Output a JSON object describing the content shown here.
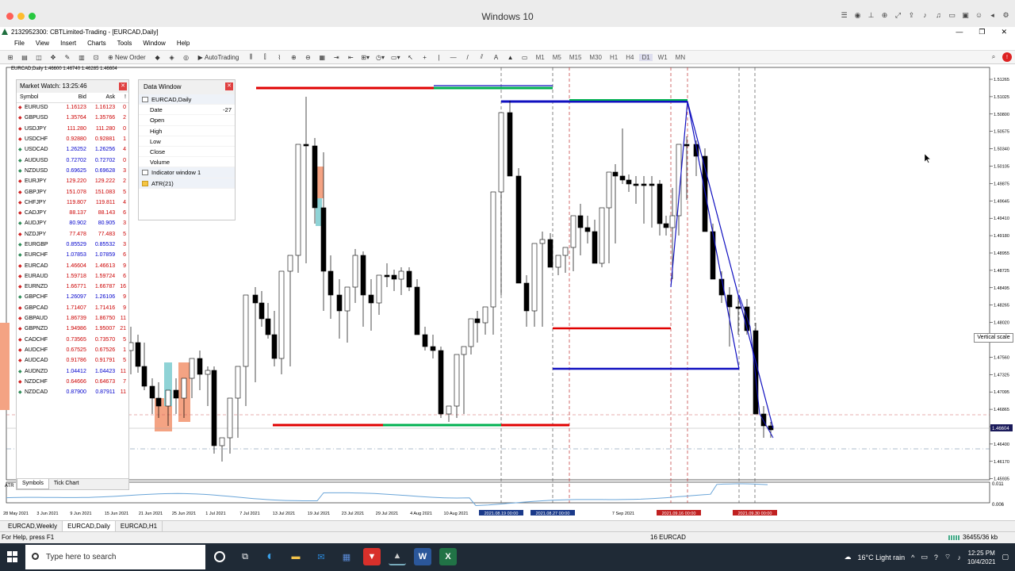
{
  "mac": {
    "title": "Windows 10"
  },
  "app": {
    "title": "2132952300: CBTLimited-Trading - [EURCAD,Daily]"
  },
  "menu": [
    "File",
    "View",
    "Insert",
    "Charts",
    "Tools",
    "Window",
    "Help"
  ],
  "toolbar": {
    "new_order": "New Order",
    "autotrading": "AutoTrading",
    "timeframes": [
      "M1",
      "M5",
      "M15",
      "M30",
      "H1",
      "H4",
      "D1",
      "W1",
      "MN"
    ]
  },
  "chart": {
    "symbol_info": "EURCAD,Daily 1.46600 1.46740 1.46285 1.46604",
    "price_labels": [
      "1.51265",
      "1.51025",
      "1.50800",
      "1.50575",
      "1.50340",
      "1.50105",
      "1.49875",
      "1.49645",
      "1.49410",
      "1.49180",
      "1.48955",
      "1.48725",
      "1.48495",
      "1.48265",
      "1.48020",
      "1.47790",
      "1.47560",
      "1.47325",
      "1.47095",
      "1.46865",
      "1.46630",
      "1.46400",
      "1.46170",
      "1.45935"
    ],
    "current_price": "1.46604",
    "indicator_label": "ATR",
    "indicator_scale": [
      "0.011",
      "0.006"
    ],
    "date_labels": [
      "28 May 2021",
      "3 Jun 2021",
      "9 Jun 2021",
      "15 Jun 2021",
      "21 Jun 2021",
      "25 Jun 2021",
      "1 Jul 2021",
      "7 Jul 2021",
      "13 Jul 2021",
      "19 Jul 2021",
      "23 Jul 2021",
      "29 Jul 2021",
      "4 Aug 2021",
      "10 Aug 2021",
      "2021.08.19 00:00",
      "2021.08.27 00:00",
      "7 Sep 2021",
      "2021.09.16 00:00",
      "2021.09.30 00:00"
    ],
    "tooltip": "Vertical scale"
  },
  "market_watch": {
    "title": "Market Watch: 13:25:46",
    "headers": [
      "Symbol",
      "Bid",
      "Ask",
      "!"
    ],
    "rows": [
      {
        "s": "EURUSD",
        "bid": "1.16123",
        "ask": "1.16123",
        "sp": "0",
        "d": "dn"
      },
      {
        "s": "GBPUSD",
        "bid": "1.35764",
        "ask": "1.35766",
        "sp": "2",
        "d": "dn"
      },
      {
        "s": "USDJPY",
        "bid": "111.280",
        "ask": "111.280",
        "sp": "0",
        "d": "dn"
      },
      {
        "s": "USDCHF",
        "bid": "0.92880",
        "ask": "0.92881",
        "sp": "1",
        "d": "dn"
      },
      {
        "s": "USDCAD",
        "bid": "1.26252",
        "ask": "1.26256",
        "sp": "4",
        "d": "up"
      },
      {
        "s": "AUDUSD",
        "bid": "0.72702",
        "ask": "0.72702",
        "sp": "0",
        "d": "up"
      },
      {
        "s": "NZDUSD",
        "bid": "0.69625",
        "ask": "0.69628",
        "sp": "3",
        "d": "up"
      },
      {
        "s": "EURJPY",
        "bid": "129.220",
        "ask": "129.222",
        "sp": "2",
        "d": "dn"
      },
      {
        "s": "GBPJPY",
        "bid": "151.078",
        "ask": "151.083",
        "sp": "5",
        "d": "dn"
      },
      {
        "s": "CHFJPY",
        "bid": "119.807",
        "ask": "119.811",
        "sp": "4",
        "d": "dn"
      },
      {
        "s": "CADJPY",
        "bid": "88.137",
        "ask": "88.143",
        "sp": "6",
        "d": "dn"
      },
      {
        "s": "AUDJPY",
        "bid": "80.902",
        "ask": "80.905",
        "sp": "3",
        "d": "up"
      },
      {
        "s": "NZDJPY",
        "bid": "77.478",
        "ask": "77.483",
        "sp": "5",
        "d": "dn"
      },
      {
        "s": "EURGBP",
        "bid": "0.85529",
        "ask": "0.85532",
        "sp": "3",
        "d": "up"
      },
      {
        "s": "EURCHF",
        "bid": "1.07853",
        "ask": "1.07859",
        "sp": "6",
        "d": "up"
      },
      {
        "s": "EURCAD",
        "bid": "1.46604",
        "ask": "1.46613",
        "sp": "9",
        "d": "dn"
      },
      {
        "s": "EURAUD",
        "bid": "1.59718",
        "ask": "1.59724",
        "sp": "6",
        "d": "dn"
      },
      {
        "s": "EURNZD",
        "bid": "1.66771",
        "ask": "1.66787",
        "sp": "16",
        "d": "dn"
      },
      {
        "s": "GBPCHF",
        "bid": "1.26097",
        "ask": "1.26106",
        "sp": "9",
        "d": "up"
      },
      {
        "s": "GBPCAD",
        "bid": "1.71407",
        "ask": "1.71416",
        "sp": "9",
        "d": "dn"
      },
      {
        "s": "GBPAUD",
        "bid": "1.86739",
        "ask": "1.86750",
        "sp": "11",
        "d": "dn"
      },
      {
        "s": "GBPNZD",
        "bid": "1.94986",
        "ask": "1.95007",
        "sp": "21",
        "d": "dn"
      },
      {
        "s": "CADCHF",
        "bid": "0.73565",
        "ask": "0.73570",
        "sp": "5",
        "d": "dn"
      },
      {
        "s": "AUDCHF",
        "bid": "0.67525",
        "ask": "0.67526",
        "sp": "1",
        "d": "dn"
      },
      {
        "s": "AUDCAD",
        "bid": "0.91786",
        "ask": "0.91791",
        "sp": "5",
        "d": "dn"
      },
      {
        "s": "AUDNZD",
        "bid": "1.04412",
        "ask": "1.04423",
        "sp": "11",
        "d": "up"
      },
      {
        "s": "NZDCHF",
        "bid": "0.64666",
        "ask": "0.64673",
        "sp": "7",
        "d": "dn"
      },
      {
        "s": "NZDCAD",
        "bid": "0.87900",
        "ask": "0.87911",
        "sp": "11",
        "d": "up"
      }
    ],
    "tabs": [
      "Symbols",
      "Tick Chart"
    ]
  },
  "data_window": {
    "title": "Data Window",
    "symbol": "EURCAD,Daily",
    "fields": [
      {
        "k": "Date",
        "v": "-27"
      },
      {
        "k": "Open",
        "v": ""
      },
      {
        "k": "High",
        "v": ""
      },
      {
        "k": "Low",
        "v": ""
      },
      {
        "k": "Close",
        "v": ""
      },
      {
        "k": "Volume",
        "v": ""
      }
    ],
    "indicator_window": "Indicator window 1",
    "indicator": "ATR(21)"
  },
  "chart_tabs": [
    "EURCAD,Weekly",
    "EURCAD,Daily",
    "EURCAD,H1"
  ],
  "status": {
    "help": "For Help, press F1",
    "profile": "16 EURCAD",
    "traffic": "36455/36 kb"
  },
  "taskbar": {
    "search": "Type here to search",
    "weather": "16°C  Light rain",
    "time": "12:25 PM",
    "date": "10/4/2021"
  },
  "colors": {
    "sell_line": "#e00000",
    "buy_line": "#00b050",
    "level_blue": "#1010c0"
  }
}
